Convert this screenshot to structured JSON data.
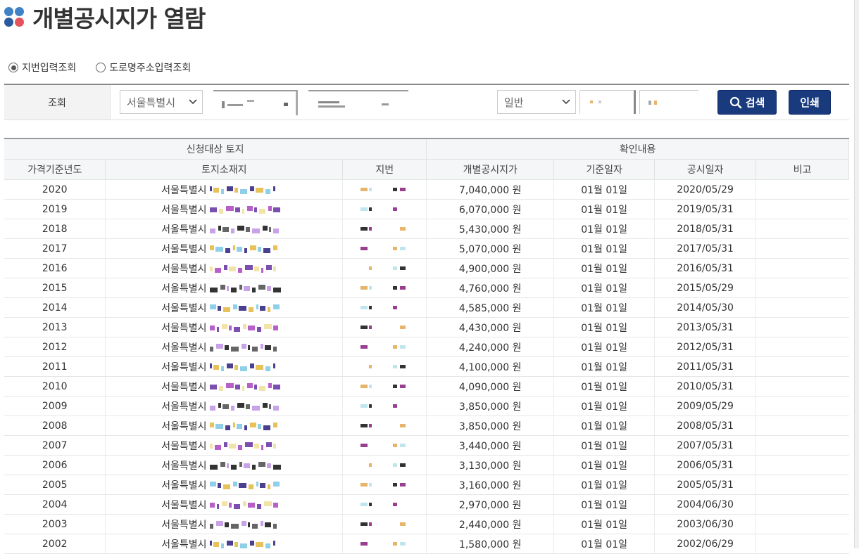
{
  "page": {
    "title": "개별공시지가 열람",
    "colors": {
      "accent": "#1a3a7e",
      "dot_blue": "#3f83c6",
      "dot_navy": "#2b5a9f",
      "dot_red": "#e4525b"
    }
  },
  "search_mode": {
    "options": [
      {
        "label": "지번입력조회",
        "selected": true
      },
      {
        "label": "도로명주소입력조회",
        "selected": false
      }
    ]
  },
  "search": {
    "label": "조회",
    "sido_select": "서울특별시",
    "type_select": "일반",
    "search_button": "검색",
    "print_button": "인쇄",
    "icons": {
      "search": "search-icon",
      "dropdown": "chevron-down-icon"
    }
  },
  "table": {
    "group_headers": [
      "신청대상 토지",
      "확인내용"
    ],
    "columns": [
      "가격기준년도",
      "토지소재지",
      "지번",
      "개별공시지가",
      "기준일자",
      "공시일자",
      "비고"
    ],
    "rows": [
      {
        "year": "2020",
        "location": "서울특별시",
        "price": "7,040,000 원",
        "base_date": "01월 01일",
        "announce_date": "2020/05/29",
        "note": ""
      },
      {
        "year": "2019",
        "location": "서울특별시",
        "price": "6,070,000 원",
        "base_date": "01월 01일",
        "announce_date": "2019/05/31",
        "note": ""
      },
      {
        "year": "2018",
        "location": "서울특별시",
        "price": "5,430,000 원",
        "base_date": "01월 01일",
        "announce_date": "2018/05/31",
        "note": ""
      },
      {
        "year": "2017",
        "location": "서울특별시",
        "price": "5,070,000 원",
        "base_date": "01월 01일",
        "announce_date": "2017/05/31",
        "note": ""
      },
      {
        "year": "2016",
        "location": "서울특별시",
        "price": "4,900,000 원",
        "base_date": "01월 01일",
        "announce_date": "2016/05/31",
        "note": ""
      },
      {
        "year": "2015",
        "location": "서울특별시",
        "price": "4,760,000 원",
        "base_date": "01월 01일",
        "announce_date": "2015/05/29",
        "note": ""
      },
      {
        "year": "2014",
        "location": "서울특별시",
        "price": "4,585,000 원",
        "base_date": "01월 01일",
        "announce_date": "2014/05/30",
        "note": ""
      },
      {
        "year": "2013",
        "location": "서울특별시",
        "price": "4,430,000 원",
        "base_date": "01월 01일",
        "announce_date": "2013/05/31",
        "note": ""
      },
      {
        "year": "2012",
        "location": "서울특별시",
        "price": "4,240,000 원",
        "base_date": "01월 01일",
        "announce_date": "2012/05/31",
        "note": ""
      },
      {
        "year": "2011",
        "location": "서울특별시",
        "price": "4,100,000 원",
        "base_date": "01월 01일",
        "announce_date": "2011/05/31",
        "note": ""
      },
      {
        "year": "2010",
        "location": "서울특별시",
        "price": "4,090,000 원",
        "base_date": "01월 01일",
        "announce_date": "2010/05/31",
        "note": ""
      },
      {
        "year": "2009",
        "location": "서울특별시",
        "price": "3,850,000 원",
        "base_date": "01월 01일",
        "announce_date": "2009/05/29",
        "note": ""
      },
      {
        "year": "2008",
        "location": "서울특별시",
        "price": "3,850,000 원",
        "base_date": "01월 01일",
        "announce_date": "2008/05/31",
        "note": ""
      },
      {
        "year": "2007",
        "location": "서울특별시",
        "price": "3,440,000 원",
        "base_date": "01월 01일",
        "announce_date": "2007/05/31",
        "note": ""
      },
      {
        "year": "2006",
        "location": "서울특별시",
        "price": "3,130,000 원",
        "base_date": "01월 01일",
        "announce_date": "2006/05/31",
        "note": ""
      },
      {
        "year": "2005",
        "location": "서울특별시",
        "price": "3,160,000 원",
        "base_date": "01월 01일",
        "announce_date": "2005/05/31",
        "note": ""
      },
      {
        "year": "2004",
        "location": "서울특별시",
        "price": "2,970,000 원",
        "base_date": "01월 01일",
        "announce_date": "2004/06/30",
        "note": ""
      },
      {
        "year": "2003",
        "location": "서울특별시",
        "price": "2,440,000 원",
        "base_date": "01월 01일",
        "announce_date": "2003/06/30",
        "note": ""
      },
      {
        "year": "2002",
        "location": "서울특별시",
        "price": "1,580,000 원",
        "base_date": "01월 01일",
        "announce_date": "2002/06/29",
        "note": ""
      }
    ]
  }
}
